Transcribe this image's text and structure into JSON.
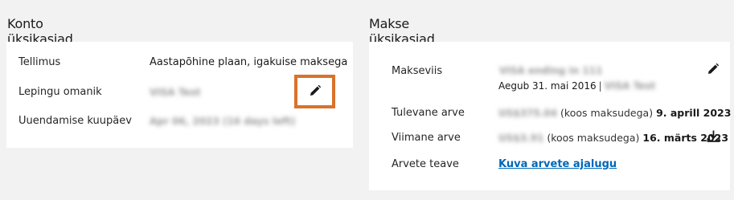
{
  "account": {
    "title": "Konto üksikasjad",
    "rows": {
      "subscription_label": "Tellimus",
      "subscription_value": "Aastapõhine plaan, igakuise maksega",
      "owner_label": "Lepingu omanik",
      "owner_value": "VISA Test",
      "renewal_label": "Uuendamise kuupäev",
      "renewal_value": "Apr 06, 2023 (16 days left)"
    },
    "edit_icon": "pencil-icon",
    "highlight_color": "#d9722a"
  },
  "payment": {
    "title": "Makse üksikasjad",
    "method_label": "Makseviis",
    "method_value": "VISA ending in 111",
    "expires_text": "Aegub 31. mai 2016",
    "separator": "|",
    "card_holder": "VISA Test",
    "next_label": "Tulevane arve",
    "next_amount": "US$375.04",
    "next_tax_note": "(koos maksudega)",
    "next_date": "9. aprill 2023",
    "last_label": "Viimane arve",
    "last_amount": "US$3.91",
    "last_tax_note": "(koos maksudega)",
    "last_date": "16. märts 2023",
    "info_label": "Arvete teave",
    "history_link": "Kuva arvete ajalugu",
    "edit_icon": "pencil-icon",
    "download_icon": "download-icon",
    "link_color": "#0067b8"
  }
}
